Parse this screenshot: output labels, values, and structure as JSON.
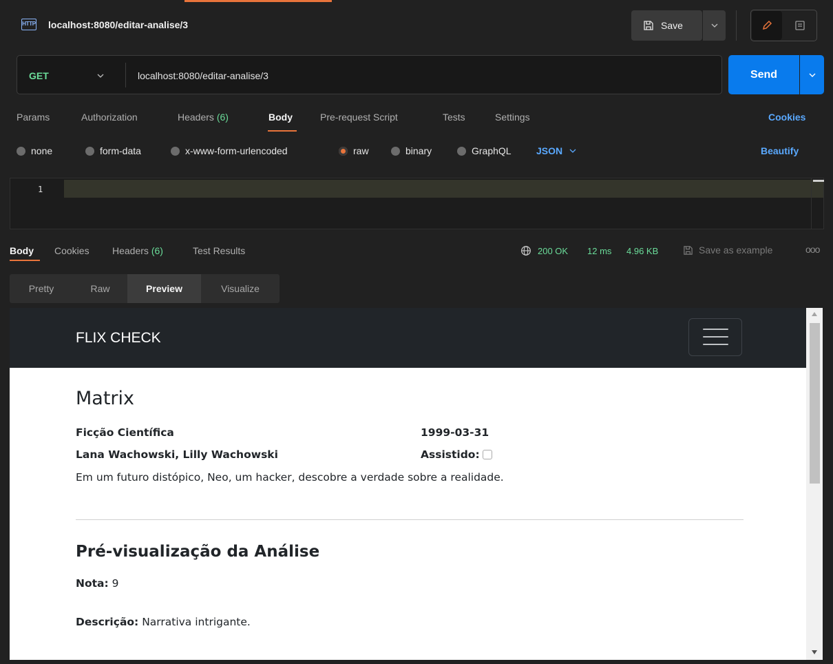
{
  "request": {
    "tab_title": "localhost:8080/editar-analise/3",
    "save_label": "Save",
    "method": "GET",
    "url": "localhost:8080/editar-analise/3",
    "send_label": "Send"
  },
  "request_tabs": {
    "params": "Params",
    "authorization": "Authorization",
    "headers": "Headers",
    "headers_count": "(6)",
    "body": "Body",
    "prerequest": "Pre-request Script",
    "tests": "Tests",
    "settings": "Settings",
    "cookies": "Cookies"
  },
  "body_types": {
    "none": "none",
    "form_data": "form-data",
    "urlencoded": "x-www-form-urlencoded",
    "raw": "raw",
    "binary": "binary",
    "graphql": "GraphQL",
    "format": "JSON",
    "beautify": "Beautify",
    "selected": "raw"
  },
  "editor": {
    "line_number": "1"
  },
  "response_tabs": {
    "body": "Body",
    "cookies": "Cookies",
    "headers": "Headers",
    "headers_count": "(6)",
    "test_results": "Test Results"
  },
  "response_status": {
    "status": "200 OK",
    "time": "12 ms",
    "size": "4.96 KB",
    "save_example": "Save as example",
    "more": "ooo"
  },
  "view_tabs": {
    "pretty": "Pretty",
    "raw": "Raw",
    "preview": "Preview",
    "visualize": "Visualize",
    "selected": "Preview"
  },
  "preview": {
    "brand": "FLIX CHECK",
    "movie": {
      "title": "Matrix",
      "genre": "Ficção Científica",
      "release_date": "1999-03-31",
      "directors": "Lana Wachowski, Lilly Wachowski",
      "watched_label": "Assistido:",
      "watched": false,
      "synopsis": "Em um futuro distópico, Neo, um hacker, descobre a verdade sobre a realidade."
    },
    "review": {
      "section_title": "Pré-visualização da Análise",
      "rating_label": "Nota:",
      "rating_value": "9",
      "description_label": "Descrição:",
      "description_value": "Narrativa intrigante."
    }
  },
  "colors": {
    "accent": "#e8743b",
    "send": "#097bed",
    "link": "#5aa9ff",
    "success": "#6bdd9a"
  }
}
